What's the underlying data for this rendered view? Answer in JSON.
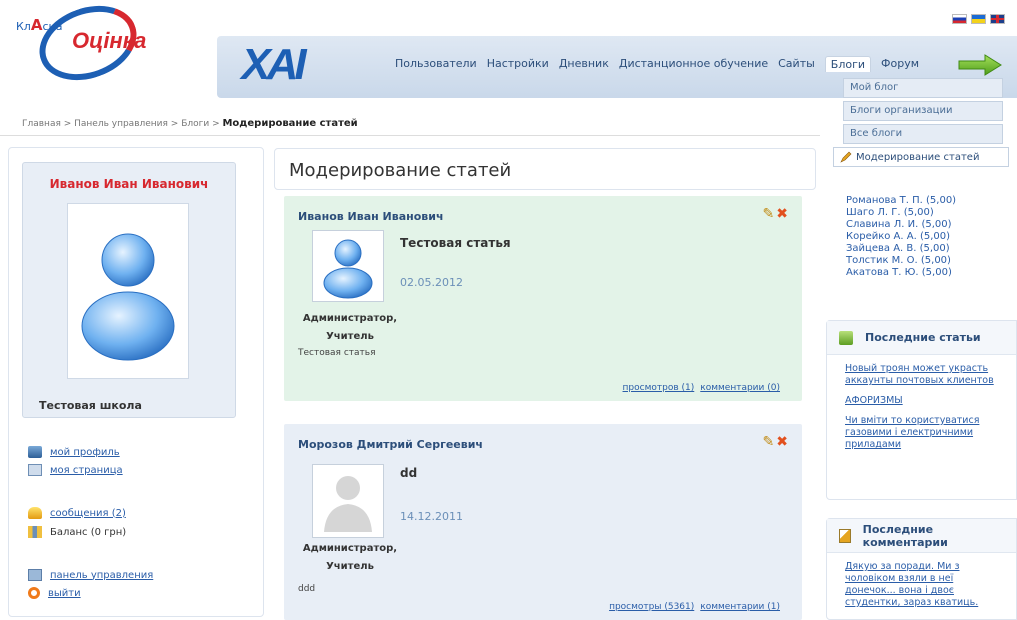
{
  "logo": {
    "prefix": "Кл",
    "mid": "А",
    "suffix": "сна",
    "word": "Оцінка"
  },
  "brand": {
    "xai": "XAI"
  },
  "nav": {
    "items": [
      "Пользователи",
      "Настройки",
      "Дневник",
      "Дистанционное обучение",
      "Сайты",
      "Блоги",
      "Форум"
    ],
    "active": "Блоги"
  },
  "dropdown": {
    "items": [
      "Мой блог",
      "Блоги организации",
      "Все блоги",
      "Модерирование статей"
    ]
  },
  "breadcrumb": {
    "path": "Главная > Панель управления > Блоги > ",
    "current": "Модерирование статей"
  },
  "profile": {
    "name": "Иванов Иван Иванович",
    "school": "Тестовая школа"
  },
  "side_links": {
    "my_profile": "мой профиль",
    "my_page": "моя страница",
    "messages": "сообщения (2)",
    "balance": "Баланс (0 грн)",
    "control_panel": "панель управления",
    "logout": "выйти"
  },
  "page_title": "Модерирование статей",
  "posts": [
    {
      "author": "Иванов Иван Иванович",
      "title": "Тестовая статья",
      "date": "02.05.2012",
      "role_line1": "Администратор,",
      "role_line2": "Учитель",
      "excerpt": "Тестовая статья",
      "views": "просмотров (1)",
      "comments": "комментарии (0)"
    },
    {
      "author": "Морозов Дмитрий Сергеевич",
      "title": "dd",
      "date": "14.12.2011",
      "role_line1": "Администратор,",
      "role_line2": "Учитель",
      "excerpt": "ddd",
      "views": "просмотры (5361)",
      "comments": "комментарии (1)"
    }
  ],
  "ranking": [
    "Романова Т. П. (5,00)",
    "Шаго Л. Г. (5,00)",
    "Славина Л. И. (5,00)",
    "Корейко А. А. (5,00)",
    "Зайцева А. В. (5,00)",
    "Толстик М. О. (5,00)",
    "Акатова Т. Ю. (5,00)"
  ],
  "latest_articles": {
    "title": "Последние статьи",
    "items": [
      "Новый троян может украсть аккаунты почтовых клиентов",
      "АФОРИЗМЫ",
      "Чи вміти то користуватися газовими і електричними приладами"
    ]
  },
  "latest_comments": {
    "title": "Последние комментарии",
    "items": [
      "Дякую за поради. Ми з чоловіком взяли в неї донечок... вона і двоє студентки, зараз кватиць."
    ]
  },
  "colors": {
    "brand_blue": "#1d5fb4",
    "brand_red": "#d7282f",
    "post_green": "#e3f3e8",
    "post_blue": "#e8eef6"
  }
}
